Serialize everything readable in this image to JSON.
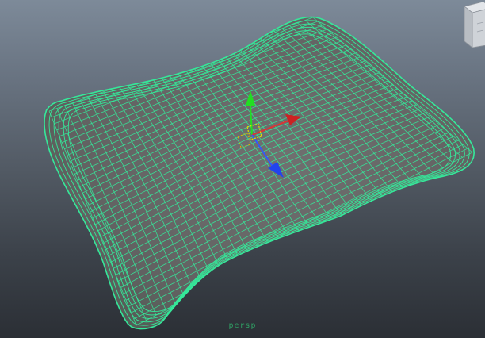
{
  "viewport": {
    "camera_name": "persp",
    "mesh": {
      "wireframe_color": "#35e89a",
      "fill_color": "#686868",
      "selected": true
    },
    "manipulator": {
      "type": "move-tool",
      "colors": {
        "y_axis": "#22dd22",
        "x_axis": "#dd2222",
        "z_axis": "#2244ee",
        "center": "#e0e000"
      }
    },
    "viewcube": {
      "face_color": "#c9cdd2",
      "edge_color": "#8a9098"
    }
  }
}
